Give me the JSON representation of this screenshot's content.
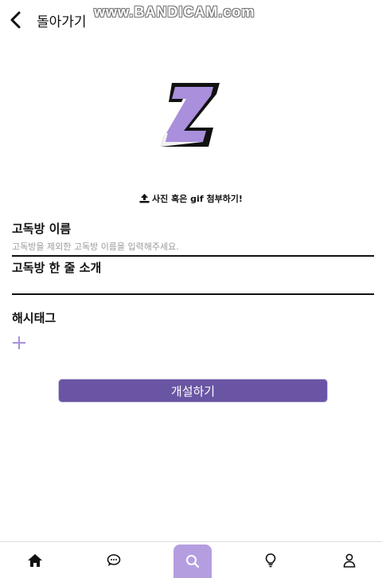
{
  "header": {
    "back_label": "돌아가기",
    "watermark": "www.BANDICAM.com"
  },
  "logo": {
    "icon": "z-logo-icon",
    "color": "#a98fdc"
  },
  "attach": {
    "label": "사진 혹은 gif 첨부하기!",
    "icon": "upload-icon"
  },
  "form": {
    "name_label": "고독방 이름",
    "name_placeholder": "고독방을 제외한 고독방 이름을 입력해주세요.",
    "intro_label": "고독방 한 줄 소개",
    "intro_placeholder": "",
    "hashtag_label": "해시태그",
    "hashtag_add_icon": "plus-icon"
  },
  "submit": {
    "label": "개설하기",
    "color": "#6a55a4"
  },
  "bottom_nav": {
    "items": [
      {
        "icon": "home-icon",
        "active": false
      },
      {
        "icon": "chat-icon",
        "active": false
      },
      {
        "icon": "search-icon",
        "active": true
      },
      {
        "icon": "lightbulb-icon",
        "active": false
      },
      {
        "icon": "user-icon",
        "active": false
      }
    ],
    "active_color": "#b49ee0"
  }
}
